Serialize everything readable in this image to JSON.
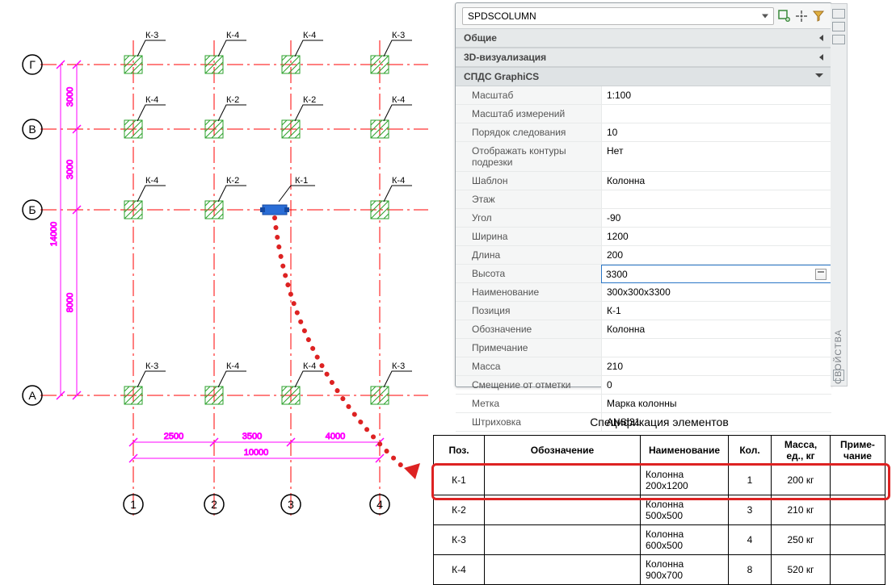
{
  "plan": {
    "axis_rows": [
      "Г",
      "В",
      "Б",
      "А"
    ],
    "axis_cols": [
      "1",
      "2",
      "3",
      "4"
    ],
    "dims_vertical": [
      "3000",
      "3000",
      "8000",
      "14000"
    ],
    "dims_horizontal": [
      "2500",
      "3500",
      "4000",
      "10000"
    ],
    "column_tags": {
      "row0": [
        "К-3",
        "К-4",
        "К-4",
        "К-3"
      ],
      "row1": [
        "К-4",
        "К-2",
        "К-2",
        "К-4"
      ],
      "row2": [
        "К-4",
        "К-2",
        "К-1",
        "К-4"
      ],
      "row3": [],
      "row4": [
        "К-3",
        "К-4",
        "К-4",
        "К-3"
      ]
    },
    "selected": "К-1"
  },
  "palette": {
    "type_value": "SPDSCOLUMN",
    "sidebar_label": "СВОЙСТВА",
    "sections": [
      {
        "title": "Общие",
        "open": false
      },
      {
        "title": "3D-визуализация",
        "open": false
      },
      {
        "title": "СПДС GraphiCS",
        "open": true
      }
    ],
    "props": [
      {
        "label": "Масштаб",
        "value": "1:100"
      },
      {
        "label": "Масштаб измерений",
        "value": ""
      },
      {
        "label": "Порядок следования",
        "value": "10"
      },
      {
        "label": "Отображать контуры подрезки",
        "value": "Нет"
      },
      {
        "label": "Шаблон",
        "value": "Колонна"
      },
      {
        "label": "Этаж",
        "value": ""
      },
      {
        "label": "Угол",
        "value": "-90"
      },
      {
        "label": "Ширина",
        "value": "1200"
      },
      {
        "label": "Длина",
        "value": "200"
      },
      {
        "label": "Высота",
        "value": "3300",
        "edit": true
      },
      {
        "label": "Наименование",
        "value": "300x300x3300"
      },
      {
        "label": "Позиция",
        "value": "К-1"
      },
      {
        "label": "Обозначение",
        "value": "Колонна"
      },
      {
        "label": "Примечание",
        "value": ""
      },
      {
        "label": "Масса",
        "value": "210"
      },
      {
        "label": "Смещение от отметки",
        "value": "0"
      },
      {
        "label": "Метка",
        "value": "Марка колонны"
      },
      {
        "label": "Штриховка",
        "value": "ANSI31"
      }
    ]
  },
  "spec": {
    "title": "Спецификация элементов",
    "headers": [
      "Поз.",
      "Обозначение",
      "Наименование",
      "Кол.",
      "Масса, ед., кг",
      "Приме-\nчание"
    ],
    "rows": [
      {
        "pos": "К-1",
        "obo": "",
        "name": "Колонна 200x1200",
        "qty": "1",
        "mass": "200 кг",
        "note": "",
        "highlight": true
      },
      {
        "pos": "К-2",
        "obo": "",
        "name": "Колонна 500x500",
        "qty": "3",
        "mass": "210 кг",
        "note": ""
      },
      {
        "pos": "К-3",
        "obo": "",
        "name": "Колонна 600x500",
        "qty": "4",
        "mass": "250 кг",
        "note": ""
      },
      {
        "pos": "К-4",
        "obo": "",
        "name": "Колонна 900x700",
        "qty": "8",
        "mass": "520 кг",
        "note": ""
      }
    ]
  }
}
